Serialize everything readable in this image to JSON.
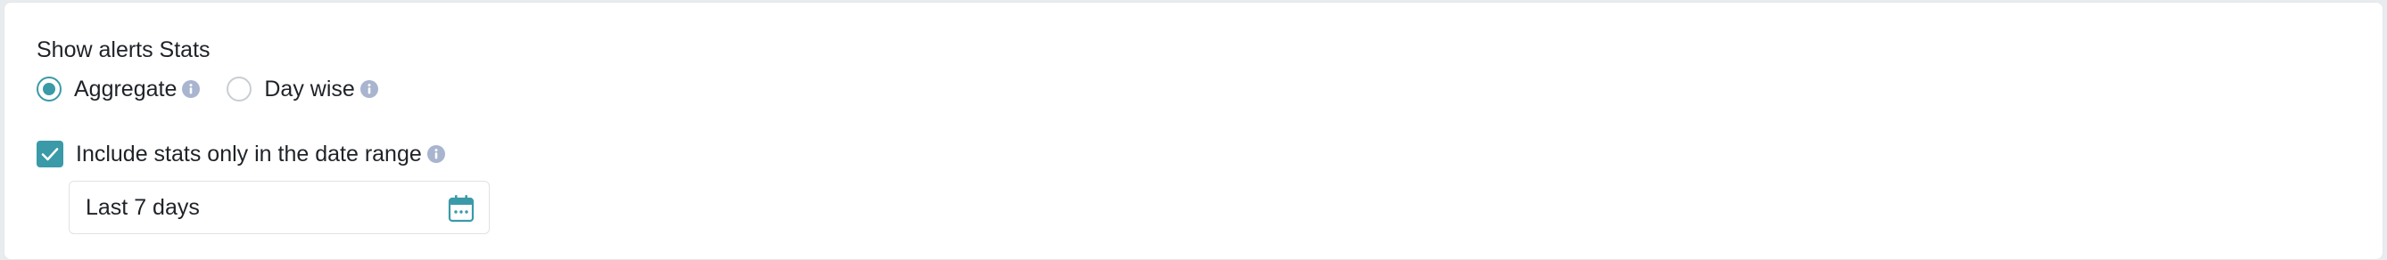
{
  "stats": {
    "title": "Show alerts Stats",
    "options": [
      {
        "label": "Aggregate",
        "selected": true,
        "icon": "info-icon"
      },
      {
        "label": "Day wise",
        "selected": false,
        "icon": "info-icon"
      }
    ],
    "date_range_toggle": {
      "label": "Include stats only in the date range",
      "checked": true,
      "icon": "info-icon"
    },
    "date_range": {
      "value": "Last 7 days",
      "icon": "calendar-icon"
    }
  },
  "colors": {
    "accent": "#3a9aa8",
    "info_icon": "#a9b4cf",
    "text": "#1f2328"
  }
}
